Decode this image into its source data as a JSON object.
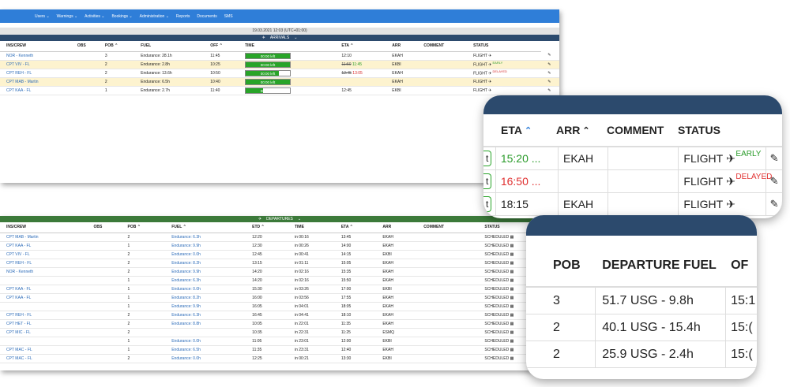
{
  "nav": {
    "items": [
      "Users",
      "Warnings",
      "Activities",
      "Bookings",
      "Administration",
      "Reports",
      "Documents",
      "SMS"
    ]
  },
  "date_bar": "19.03.2021 12:03  (UTC+01:00)",
  "arrivals": {
    "title": "ARRIVALS",
    "columns": [
      "INS/CREW",
      "OBS",
      "POB",
      "FUEL",
      "OFF",
      "TIME",
      "ETA",
      "ARR",
      "COMMENT",
      "STATUS"
    ],
    "rows": [
      {
        "crew": "NOR - Kenneth",
        "pob": "3",
        "fuel": "Endurance: 28.1h",
        "off": "11:45",
        "time": "00:00 left",
        "time_pct": 100,
        "eta": "12:10",
        "eta_old": "",
        "eta_new": "",
        "arr": "EKAH",
        "status": "FLIGHT",
        "tag": "",
        "highlight": false
      },
      {
        "crew": "CPT VIV - FL",
        "pob": "2",
        "fuel": "Endurance: 2.8h",
        "off": "10:25",
        "time": "00:00 left",
        "time_pct": 100,
        "eta": "",
        "eta_old": "11:50",
        "eta_new": "11:45",
        "eta_kind": "early",
        "arr": "EKBI",
        "status": "FLIGHT",
        "tag": "EARLY",
        "tag_kind": "early",
        "highlight": true
      },
      {
        "crew": "CPT REH - FL",
        "pob": "2",
        "fuel": "Endurance: 13.6h",
        "off": "10:50",
        "time": "00:00 left",
        "time_pct": 75,
        "eta": "",
        "eta_old": "12:45",
        "eta_new": "13:05",
        "eta_kind": "delayed",
        "arr": "EKAH",
        "status": "FLIGHT",
        "tag": "DELAYED",
        "tag_kind": "delayed",
        "highlight": false
      },
      {
        "crew": "CPT MAB - Martin",
        "pob": "2",
        "fuel": "Endurance: 6.5h",
        "off": "10:40",
        "time": "00:00 left",
        "time_pct": 100,
        "eta": "",
        "eta_old": "",
        "eta_new": "",
        "arr": "EKAH",
        "status": "FLIGHT",
        "tag": "",
        "highlight": true
      },
      {
        "crew": "CPT KAA - FL",
        "pob": "1",
        "fuel": "Endurance: 2.7h",
        "off": "11:40",
        "time": "00:41 left",
        "time_pct": 40,
        "eta": "12:45",
        "eta_old": "",
        "eta_new": "",
        "arr": "EKBI",
        "status": "FLIGHT",
        "tag": "",
        "highlight": false
      }
    ]
  },
  "departures": {
    "title": "DEPARTURES",
    "columns": [
      "INS/CREW",
      "OBS",
      "POB",
      "FUEL",
      "ETD",
      "TIME",
      "ETA",
      "ARR",
      "COMMENT",
      "STATUS"
    ],
    "rows": [
      {
        "crew": "CPT MAB - Martin",
        "pob": "2",
        "fuel": "Endurance: 6.3h",
        "etd": "12:20",
        "time": "in 00:16",
        "eta": "13:45",
        "arr": "EKAH",
        "status": "SCHEDULED"
      },
      {
        "crew": "CPT KAA - FL",
        "pob": "1",
        "fuel": "Endurance: 9.9h",
        "etd": "12:30",
        "time": "in 00:26",
        "eta": "14:00",
        "arr": "EKAH",
        "status": "SCHEDULED"
      },
      {
        "crew": "CPT VIV - FL",
        "pob": "2",
        "fuel": "Endurance: 0.0h",
        "etd": "12:45",
        "time": "in 00:41",
        "eta": "14:15",
        "arr": "EKBI",
        "status": "SCHEDULED"
      },
      {
        "crew": "CPT REH - FL",
        "pob": "2",
        "fuel": "Endurance: 8.2h",
        "etd": "13:15",
        "time": "in 01:11",
        "eta": "15:05",
        "arr": "EKAH",
        "status": "SCHEDULED"
      },
      {
        "crew": "NOR - Kenneth",
        "pob": "2",
        "fuel": "Endurance: 9.9h",
        "etd": "14:20",
        "time": "in 02:16",
        "eta": "15:35",
        "arr": "EKAH",
        "status": "SCHEDULED"
      },
      {
        "crew": "",
        "pob": "1",
        "fuel": "Endurance: 6.3h",
        "etd": "14:20",
        "time": "in 02:16",
        "eta": "15:50",
        "arr": "EKAH",
        "status": "SCHEDULED"
      },
      {
        "crew": "CPT KAA - FL",
        "pob": "1",
        "fuel": "Endurance: 0.0h",
        "etd": "15:30",
        "time": "in 03:26",
        "eta": "17:00",
        "arr": "EKBI",
        "status": "SCHEDULED"
      },
      {
        "crew": "CPT KAA - FL",
        "pob": "1",
        "fuel": "Endurance: 8.2h",
        "etd": "16:00",
        "time": "in 03:56",
        "eta": "17:55",
        "arr": "EKAH",
        "status": "SCHEDULED"
      },
      {
        "crew": "",
        "pob": "1",
        "fuel": "Endurance: 9.9h",
        "etd": "16:05",
        "time": "in 04:01",
        "eta": "18:05",
        "arr": "EKAH",
        "status": "SCHEDULED"
      },
      {
        "crew": "CPT REH - FL",
        "pob": "2",
        "fuel": "Endurance: 6.3h",
        "etd": "16:45",
        "time": "in 04:41",
        "eta": "18:10",
        "arr": "EKAH",
        "status": "SCHEDULED"
      },
      {
        "crew": "CPT HET - FL",
        "pob": "2",
        "fuel": "Endurance: 8.8h",
        "etd": "10:05",
        "time": "in 22:01",
        "eta": "11:35",
        "arr": "EKAH",
        "status": "SCHEDULED"
      },
      {
        "crew": "CPT MIC - FL",
        "pob": "2",
        "fuel": "",
        "etd": "10:35",
        "time": "in 22:31",
        "eta": "11:25",
        "arr": "ESMQ",
        "status": "SCHEDULED"
      },
      {
        "crew": "",
        "pob": "1",
        "fuel": "Endurance: 0.0h",
        "etd": "11:05",
        "time": "in 23:01",
        "eta": "12:00",
        "arr": "EKBI",
        "status": "SCHEDULED"
      },
      {
        "crew": "CPT MAC - FL",
        "pob": "1",
        "fuel": "Endurance: 6.5h",
        "etd": "11:35",
        "time": "in 23:31",
        "eta": "12:40",
        "arr": "EKAH",
        "status": "SCHEDULED"
      },
      {
        "crew": "CPT MAC - FL",
        "pob": "2",
        "fuel": "Endurance: 0.0h",
        "etd": "12:25",
        "time": "in 00:21",
        "eta": "13:30",
        "arr": "EKBI",
        "status": "SCHEDULED"
      }
    ]
  },
  "zoom_arrivals": {
    "headers": {
      "eta": "ETA",
      "arr": "ARR",
      "comment": "COMMENT",
      "status": "STATUS"
    },
    "partial_time": "t",
    "rows": [
      {
        "eta": "15:20 ...",
        "eta_kind": "early",
        "arr": "EKAH",
        "status": "FLIGHT",
        "tag": "EARLY",
        "tag_kind": "early"
      },
      {
        "eta": "16:50 ...",
        "eta_kind": "delayed",
        "arr": "",
        "status": "FLIGHT",
        "tag": "DELAYED",
        "tag_kind": "delayed"
      },
      {
        "eta": "18:15",
        "eta_kind": "normal",
        "arr": "EKAH",
        "status": "FLIGHT",
        "tag": "",
        "tag_kind": ""
      }
    ],
    "colors": {
      "early": "#2a9b2a",
      "delayed": "#e03030",
      "accent": "#2f7ed8",
      "band": "#2c4a6d"
    }
  },
  "zoom_departures": {
    "headers": {
      "pob": "POB",
      "fuel": "DEPARTURE FUEL",
      "next": "OF"
    },
    "rows": [
      {
        "pob": "3",
        "fuel": "51.7 USG - 9.8h",
        "next": "15:1"
      },
      {
        "pob": "2",
        "fuel": "40.1 USG - 15.4h",
        "next": "15:("
      },
      {
        "pob": "2",
        "fuel": "25.9 USG - 2.4h",
        "next": "15:("
      }
    ]
  }
}
